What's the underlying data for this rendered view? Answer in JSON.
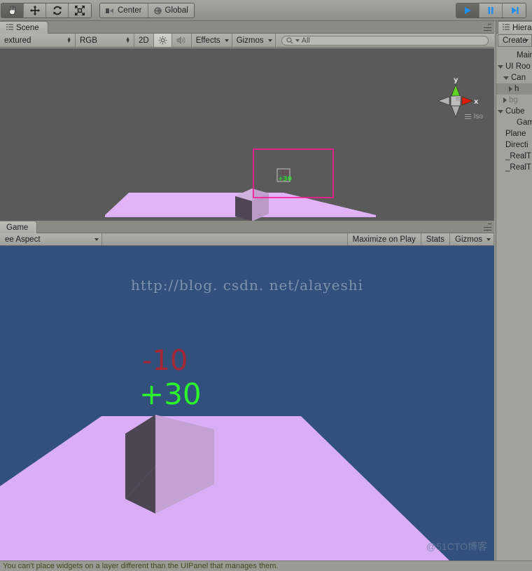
{
  "toolbar": {
    "tools": [
      {
        "name": "hand-tool",
        "icon": "hand",
        "active": true
      },
      {
        "name": "move-tool",
        "icon": "move",
        "active": false
      },
      {
        "name": "rotate-tool",
        "icon": "rotate",
        "active": false
      },
      {
        "name": "rect-tool",
        "icon": "rect-transform",
        "active": false
      }
    ],
    "pivot_label": "Center",
    "space_label": "Global",
    "play_label": "play-icon",
    "pause_label": "pause-icon",
    "step_label": "step-icon"
  },
  "scene": {
    "tab_label": "Scene",
    "draw_mode": "extured",
    "color_mode": "RGB",
    "mode_2d": "2D",
    "lighting_icon": "sun-icon",
    "audio_icon": "speaker-icon",
    "effects_label": "Effects",
    "gizmos_label": "Gizmos",
    "search_placeholder": "All",
    "search_value": "All",
    "gizmo": {
      "y_label": "y",
      "x_label": "x",
      "projection": "Iso"
    },
    "colors": {
      "viewport_bg": "#5a5a5a",
      "plane": "#e1b4f7",
      "canvas_rect": "#ff1493",
      "cube_light": "#c8a7d8",
      "cube_dark": "#4f4554"
    },
    "overlay_minus": "-10",
    "overlay_plus": "+30"
  },
  "game": {
    "tab_label": "Game",
    "aspect_label": "ee Aspect",
    "maximize_label": "Maximize on Play",
    "stats_label": "Stats",
    "gizmos_label": "Gizmos",
    "watermark_url": "http://blog. csdn. net/alayeshi",
    "damage_text": "-10",
    "heal_text": "+30",
    "corner_watermark": "@51CTO博客",
    "colors": {
      "sky": "#31507c",
      "ground": "#d9aef5",
      "cube_face": "#bf9dd1",
      "cube_side": "#4e4553",
      "damage": "#a32836",
      "heal": "#2bf52b"
    }
  },
  "hierarchy": {
    "tab_label": "Hiera",
    "create_label": "Create",
    "items": [
      {
        "label": "Main C",
        "indent": 2,
        "tri": "none",
        "selected": false,
        "dim": false
      },
      {
        "label": "UI Roo",
        "indent": 0,
        "tri": "down",
        "selected": false,
        "dim": false
      },
      {
        "label": "Can",
        "indent": 1,
        "tri": "down",
        "selected": false,
        "dim": false
      },
      {
        "label": "h",
        "indent": 2,
        "tri": "right",
        "selected": true,
        "dim": false
      },
      {
        "label": "bg",
        "indent": 1,
        "tri": "right",
        "selected": false,
        "dim": true
      },
      {
        "label": "Cube",
        "indent": 0,
        "tri": "down",
        "selected": false,
        "dim": false
      },
      {
        "label": "Gam",
        "indent": 2,
        "tri": "none",
        "selected": false,
        "dim": false
      },
      {
        "label": "Plane",
        "indent": 0,
        "tri": "none",
        "selected": false,
        "dim": false
      },
      {
        "label": "Directi",
        "indent": 0,
        "tri": "none",
        "selected": false,
        "dim": false
      },
      {
        "label": "_RealT",
        "indent": 0,
        "tri": "none",
        "selected": false,
        "dim": false
      },
      {
        "label": "_RealT",
        "indent": 0,
        "tri": "none",
        "selected": false,
        "dim": false
      }
    ]
  },
  "status": {
    "message": "You can't place widgets on a layer different than the UIPanel that manages them."
  }
}
